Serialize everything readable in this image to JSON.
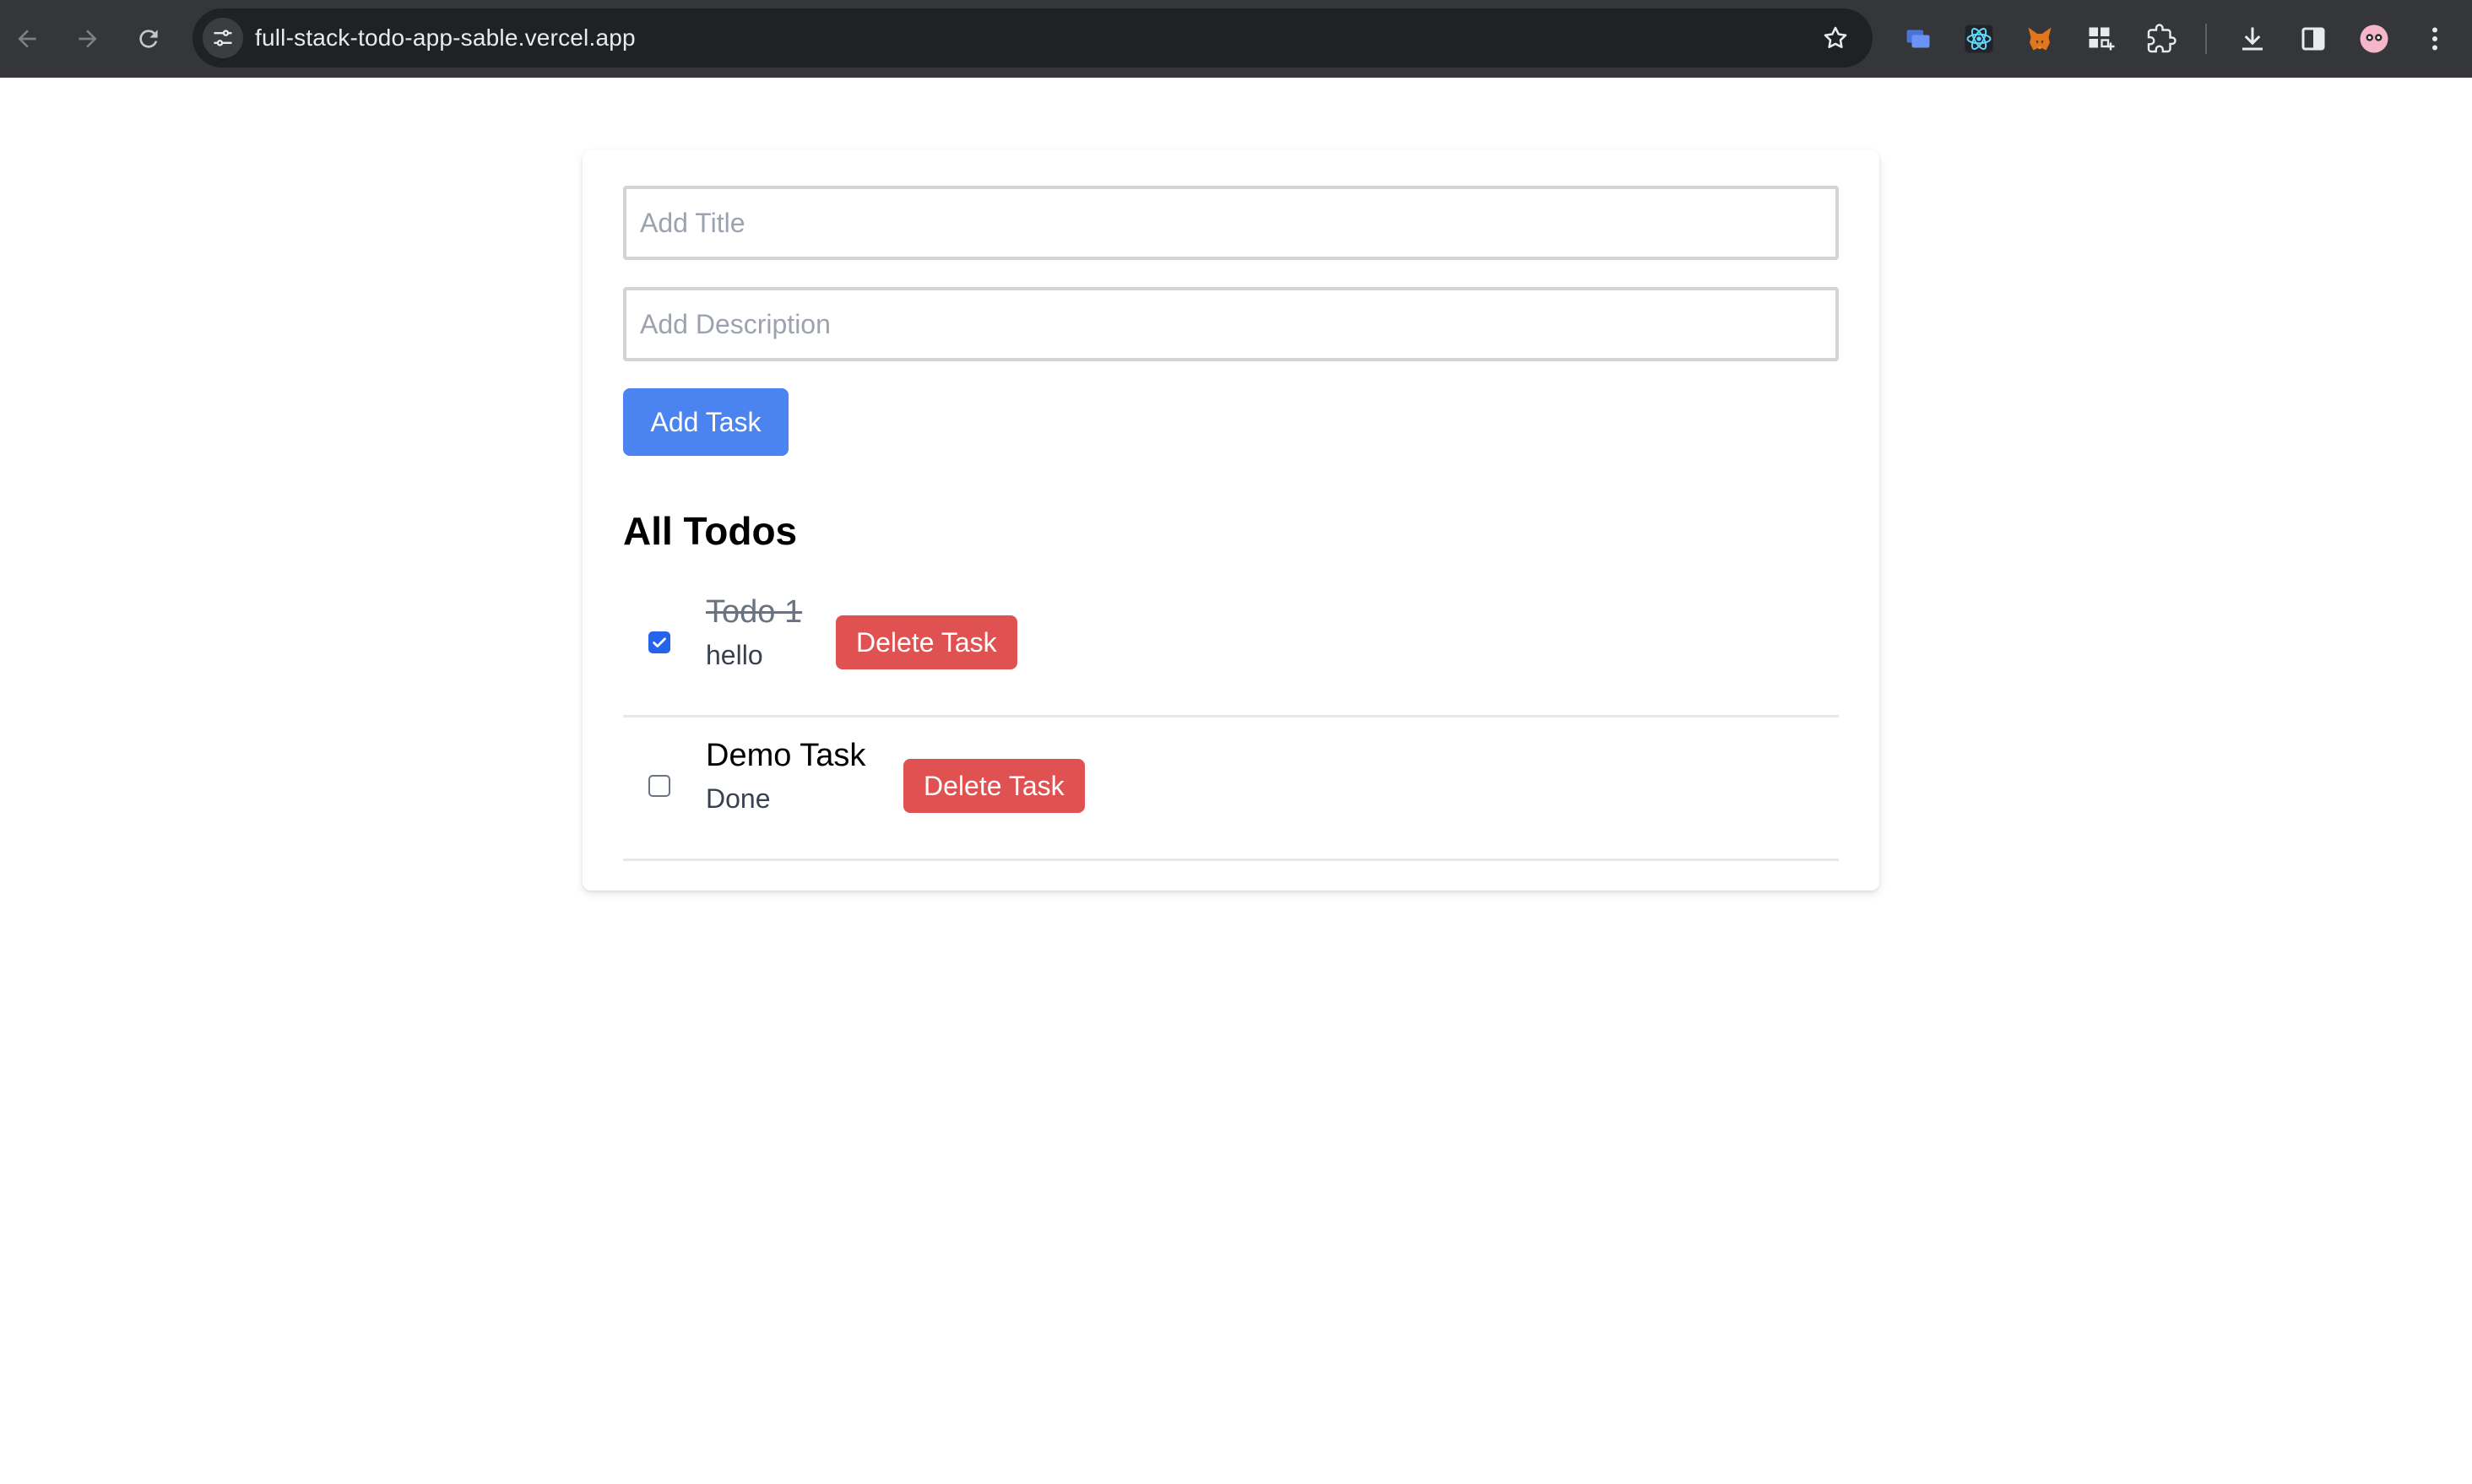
{
  "browser": {
    "url": "full-stack-todo-app-sable.vercel.app",
    "nav_icons": [
      "back-arrow-icon",
      "forward-arrow-icon",
      "reload-icon"
    ],
    "site_info_icon": "tune-icon",
    "bookmark_icon": "star-icon",
    "toolbar_icons": [
      "blue-cards-extension-icon",
      "react-devtools-icon",
      "metamask-fox-icon",
      "puzzle-grid-extension-icon",
      "extensions-puzzle-icon",
      "download-icon",
      "side-panel-icon",
      "profile-avatar-icon",
      "more-menu-icon"
    ]
  },
  "form": {
    "title_placeholder": "Add Title",
    "title_value": "",
    "description_placeholder": "Add Description",
    "description_value": "",
    "add_button_label": "Add Task"
  },
  "todos": {
    "heading": "All Todos",
    "items": [
      {
        "title": "Todo 1",
        "description": "hello",
        "completed": true,
        "delete_label": "Delete Task"
      },
      {
        "title": "Demo Task",
        "description": "Done",
        "completed": false,
        "delete_label": "Delete Task"
      }
    ]
  },
  "colors": {
    "chrome_bg": "#35363a",
    "omnibox_bg": "#202124",
    "primary_button": "#4b84f0",
    "danger_button": "#e05252",
    "checkbox_checked": "#2563eb"
  }
}
